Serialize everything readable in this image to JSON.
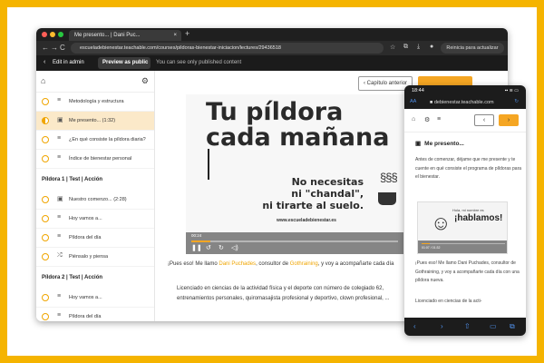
{
  "browser": {
    "tab_title": "Me presento... | Dani Puc...",
    "tab_close": "×",
    "new_tab": "+",
    "url": "escueladebienestar.teachable.com/courses/pildoras-bienestar-iniciacion/lectures/29436518",
    "update_button": "Reinicia para actualizar",
    "back": "←",
    "forward": "→",
    "reload": "C"
  },
  "admin_bar": {
    "back_arrow": "‹",
    "edit_label": "Edit in admin",
    "preview_label": "Preview as public ▾",
    "note": "You can see only published content"
  },
  "sidebar": {
    "items_top": [
      {
        "label": "Metodología y estructura",
        "icon": "list"
      },
      {
        "label": "Me presento... (1:32)",
        "icon": "video",
        "active": true
      },
      {
        "label": "¿En qué consiste la píldora diaria?",
        "icon": "list"
      },
      {
        "label": "Índice de bienestar personal",
        "icon": "list"
      }
    ],
    "section1": "Píldora 1 | Test | Acción",
    "items_s1": [
      {
        "label": "Nuestro comenzo... (2:28)",
        "icon": "video"
      },
      {
        "label": "Hoy vamos a...",
        "icon": "list"
      },
      {
        "label": "Píldora del día",
        "icon": "list"
      },
      {
        "label": "Piénsalo y piensa",
        "icon": "shuffle"
      }
    ],
    "section2": "Píldora 2 | Test | Acción",
    "items_s2": [
      {
        "label": "Hoy vamos a...",
        "icon": "list"
      },
      {
        "label": "Píldora del día",
        "icon": "list"
      }
    ]
  },
  "main": {
    "prev_button": "‹ Capítulo anterior",
    "video": {
      "title_line1": "Tu píldora",
      "title_line2": "cada mañana",
      "subtitle_line1": "No necesitas",
      "subtitle_line2": "ni \"chandal\",",
      "subtitle_line3": "ni tirarte al suelo.",
      "site": "www.escueladebienestar.es",
      "time": "00:24",
      "progress": 0.09
    },
    "intro_prefix": "¡Pues eso! Me llamo ",
    "intro_name": "Dani Puchades",
    "intro_mid": ", consultor de ",
    "intro_company": "Gothraining",
    "intro_suffix": ", y voy a acompañarte cada día",
    "paragraph": "Licenciado en ciencias de la actividad física y el deporte con número de colegiado 62, entrenamientos personales, quiromasajista profesional y deportivo, clown profesional, ..."
  },
  "phone": {
    "time": "18:44",
    "status": "▪▪ ≋ ▭",
    "aa": "AA",
    "url": "■ debienestar.teachable.com",
    "reload": "↻",
    "prev": "‹",
    "next": "›",
    "title": "Me presento...",
    "para1": "Antes de comenzar, déjame que me presente y te cuente en qué consiste el programa de píldoras para el bienestar.",
    "thumb_small": "Hola, mi nombre es",
    "thumb_big": "¡hablamos!",
    "thumb_time": "01:07 / 01:32",
    "para2": "¡Pues eso! Me llamo Dani Puchades, consultor de Gothraining, y voy a acompañarte cada día con una píldora nueva.",
    "para3": "Licenciado en ciencias de la acti-"
  },
  "colors": {
    "accent": "#f5a623",
    "background": "#f5b400"
  }
}
